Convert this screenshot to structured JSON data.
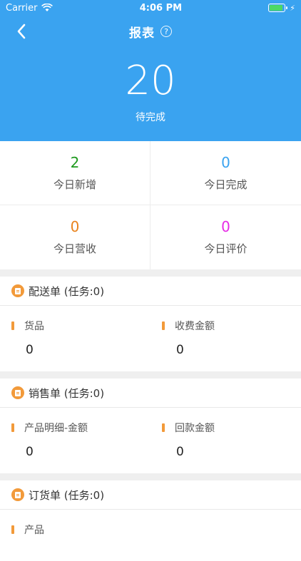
{
  "status": {
    "carrier": "Carrier",
    "time": "4:06 PM"
  },
  "nav": {
    "title": "报表",
    "help": "?"
  },
  "summary": {
    "count": "20",
    "label": "待完成"
  },
  "stats": [
    {
      "value": "2",
      "label": "今日新增",
      "color": "#1e9a1e"
    },
    {
      "value": "0",
      "label": "今日完成",
      "color": "#3aa3f0"
    },
    {
      "value": "0",
      "label": "今日营收",
      "color": "#e9831e"
    },
    {
      "value": "0",
      "label": "今日评价",
      "color": "#e62be6"
    }
  ],
  "sections": [
    {
      "title": "配送单 (任务:0)",
      "metrics": [
        {
          "label": "货品",
          "value": "0"
        },
        {
          "label": "收费金额",
          "value": "0"
        }
      ]
    },
    {
      "title": "销售单 (任务:0)",
      "metrics": [
        {
          "label": "产品明细-金额",
          "value": "0"
        },
        {
          "label": "回款金额",
          "value": "0"
        }
      ]
    },
    {
      "title": "订货单 (任务:0)",
      "metrics": [
        {
          "label": "产品",
          "value": ""
        }
      ]
    }
  ],
  "colors": {
    "header": "#3aa3f0",
    "accent": "#f29a3a"
  }
}
